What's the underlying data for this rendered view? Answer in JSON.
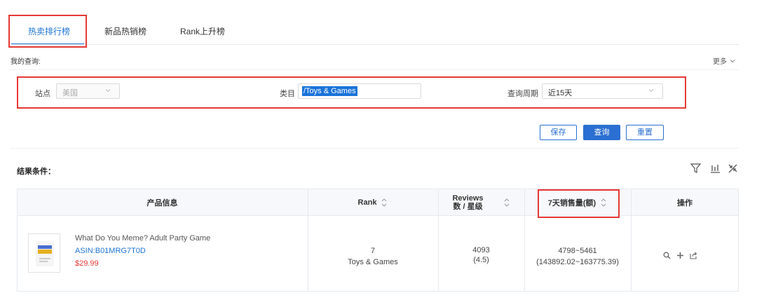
{
  "tabs": [
    {
      "label": "热卖排行榜",
      "active": true
    },
    {
      "label": "新品热销榜",
      "active": false
    },
    {
      "label": "Rank上升榜",
      "active": false
    }
  ],
  "query": {
    "my_query_label": "我的查询:",
    "more_label": "更多"
  },
  "filters": {
    "site_label": "站点",
    "site_value": "美国",
    "category_label": "类目",
    "category_value": "/Toys & Games",
    "period_label": "查询周期",
    "period_value": "近15天"
  },
  "buttons": {
    "save": "保存",
    "search": "查询",
    "reset": "重置"
  },
  "results": {
    "title": "结果条件："
  },
  "table": {
    "headers": {
      "product": "产品信息",
      "rank": "Rank",
      "reviews_line1": "Reviews",
      "reviews_line2": "数 / 星级",
      "sales": "7天销售量(额)",
      "actions": "操作"
    },
    "rows": [
      {
        "name": "What Do You Meme? Adult Party Game",
        "asin": "ASIN:B01MRG7T0D",
        "price": "$29.99",
        "rank": "7",
        "rank_category": "Toys & Games",
        "reviews": "4093",
        "stars": "(4.5)",
        "sales_range": "4798~5461",
        "sales_amount": "(143892.02~163775.39)"
      }
    ]
  },
  "colors": {
    "accent": "#1f74d6",
    "highlight_border": "#e53935",
    "price": "#e53935"
  },
  "icons": [
    "filter-icon",
    "bar-chart-icon",
    "collapse-icon",
    "search-icon",
    "plus-icon",
    "share-icon",
    "chevron-down-icon",
    "sort-icon"
  ]
}
